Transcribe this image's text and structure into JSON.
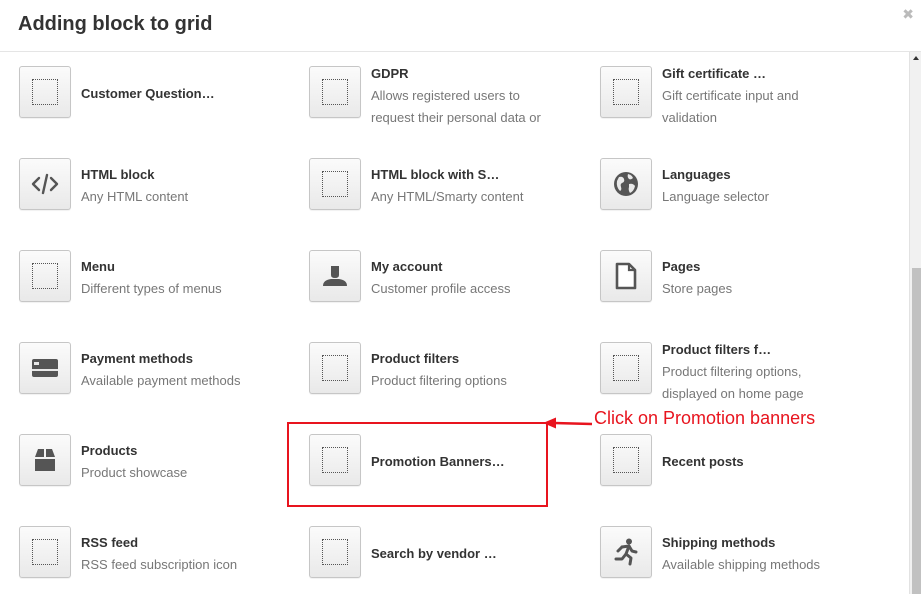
{
  "dialog": {
    "title": "Adding block to grid",
    "close_icon": "close-icon"
  },
  "blocks": [
    {
      "title": "Customer Question…",
      "desc": "",
      "icon": "placeholder-icon"
    },
    {
      "title": "GDPR",
      "desc": "Allows registered users to request their personal data or",
      "icon": "placeholder-icon"
    },
    {
      "title": "Gift certificate …",
      "desc": "Gift certificate input and validation",
      "icon": "placeholder-icon"
    },
    {
      "title": "HTML block",
      "desc": "Any HTML content",
      "icon": "code-icon"
    },
    {
      "title": "HTML block with S…",
      "desc": "Any HTML/Smarty content",
      "icon": "placeholder-icon"
    },
    {
      "title": "Languages",
      "desc": "Language selector",
      "icon": "globe-icon"
    },
    {
      "title": "Menu",
      "desc": "Different types of menus",
      "icon": "placeholder-icon"
    },
    {
      "title": "My account",
      "desc": "Customer profile access",
      "icon": "user-icon"
    },
    {
      "title": "Pages",
      "desc": "Store pages",
      "icon": "file-icon"
    },
    {
      "title": "Payment methods",
      "desc": "Available payment methods",
      "icon": "credit-card-icon"
    },
    {
      "title": "Product filters",
      "desc": "Product filtering options",
      "icon": "placeholder-icon"
    },
    {
      "title": "Product filters f…",
      "desc": "Product filtering options, displayed on home page",
      "icon": "placeholder-icon"
    },
    {
      "title": "Products",
      "desc": "Product showcase",
      "icon": "box-icon"
    },
    {
      "title": "Promotion Banners…",
      "desc": "",
      "icon": "placeholder-icon"
    },
    {
      "title": "Recent posts",
      "desc": "",
      "icon": "placeholder-icon"
    },
    {
      "title": "RSS feed",
      "desc": "RSS feed subscription icon",
      "icon": "placeholder-icon"
    },
    {
      "title": "Search by vendor …",
      "desc": "",
      "icon": "placeholder-icon"
    },
    {
      "title": "Shipping methods",
      "desc": "Available shipping methods",
      "icon": "running-man-icon"
    }
  ],
  "annotation": {
    "text": "Click on Promotion banners",
    "color": "#e8141e"
  }
}
